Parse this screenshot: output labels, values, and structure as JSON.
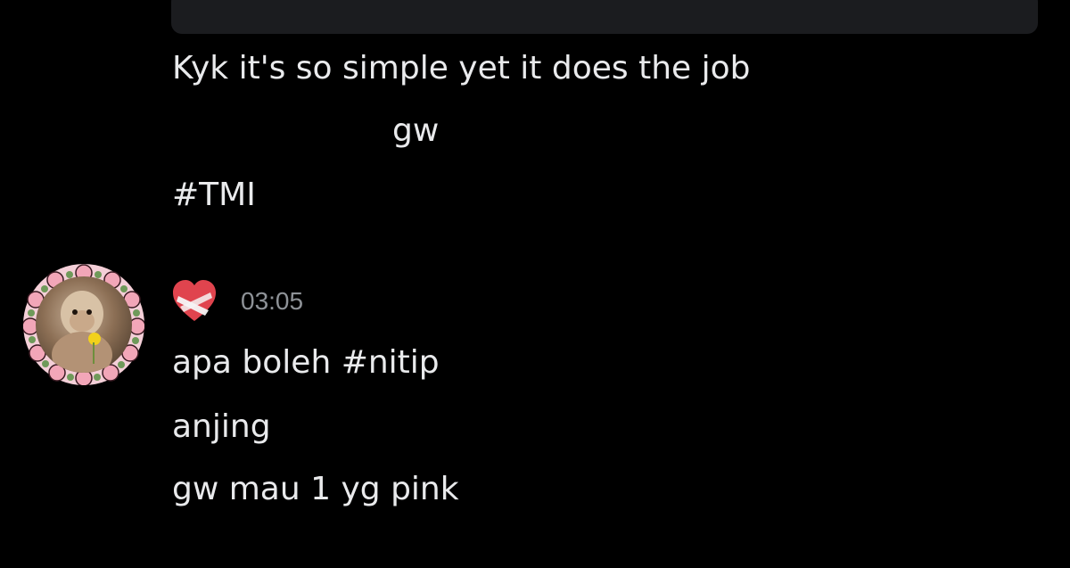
{
  "previous_messages": [
    "Kyk it's so simple yet it does the job",
    "gw",
    "#TMI"
  ],
  "message_group": {
    "author_icon": "mending-heart-icon",
    "timestamp": "03:05",
    "lines": [
      "apa boleh #nitip",
      "anjing",
      "gw mau 1 yg pink"
    ]
  },
  "colors": {
    "background": "#000000",
    "text": "#e9eaec",
    "timestamp": "#8e9297",
    "embed_bg": "#1b1c1f",
    "avatar_frame": "#f4cfd8"
  }
}
